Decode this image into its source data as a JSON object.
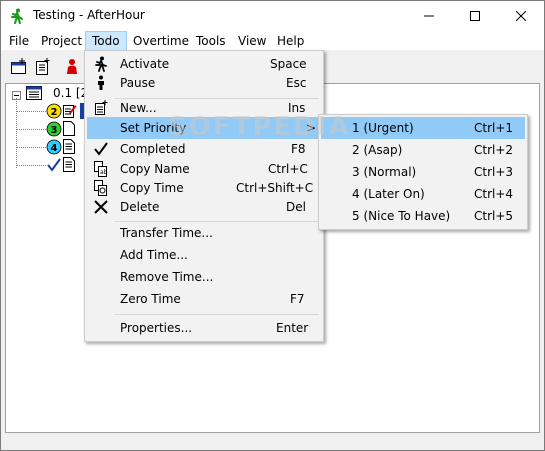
{
  "window": {
    "title": "Testing - AfterHour"
  },
  "menubar": {
    "items": [
      {
        "label": "File"
      },
      {
        "label": "Project"
      },
      {
        "label": "Todo"
      },
      {
        "label": "Overtime"
      },
      {
        "label": "Tools"
      },
      {
        "label": "View"
      },
      {
        "label": "Help"
      }
    ]
  },
  "tree": {
    "root_label": "0.1  [2",
    "priority_badges": [
      "2",
      "3",
      "4"
    ]
  },
  "todo_menu": {
    "items": [
      {
        "label": "Activate",
        "shortcut": "Space",
        "icon": "running-person-icon"
      },
      {
        "label": "Pause",
        "shortcut": "Esc",
        "icon": "standing-person-icon"
      },
      {
        "label": "New...",
        "shortcut": "Ins",
        "icon": "new-task-icon"
      },
      {
        "label": "Set Priority",
        "shortcut": ">",
        "icon": ""
      },
      {
        "label": "Completed",
        "shortcut": "F8",
        "icon": "checkmark-icon"
      },
      {
        "label": "Copy Name",
        "shortcut": "Ctrl+C",
        "icon": "copy-name-icon"
      },
      {
        "label": "Copy Time",
        "shortcut": "Ctrl+Shift+C",
        "icon": "copy-time-icon"
      },
      {
        "label": "Delete",
        "shortcut": "Del",
        "icon": "delete-icon"
      },
      {
        "label": "Transfer Time...",
        "shortcut": ""
      },
      {
        "label": "Add Time...",
        "shortcut": ""
      },
      {
        "label": "Remove Time...",
        "shortcut": ""
      },
      {
        "label": "Zero Time",
        "shortcut": "F7"
      },
      {
        "label": "Properties...",
        "shortcut": "Enter"
      }
    ]
  },
  "priority_menu": {
    "items": [
      {
        "label": "1 (Urgent)",
        "shortcut": "Ctrl+1"
      },
      {
        "label": "2 (Asap)",
        "shortcut": "Ctrl+2"
      },
      {
        "label": "3 (Normal)",
        "shortcut": "Ctrl+3"
      },
      {
        "label": "4 (Later On)",
        "shortcut": "Ctrl+4"
      },
      {
        "label": "5 (Nice To Have)",
        "shortcut": "Ctrl+5"
      }
    ]
  },
  "watermark": "SOFTPEDIA",
  "colors": {
    "highlight": "#91c9f7",
    "menu_open": "#cce8ff",
    "badge_yellow": "#ffe000",
    "badge_green": "#33cc33",
    "badge_cyan": "#33ccff",
    "accent_green": "#1a9a1a",
    "red": "#d40000"
  }
}
